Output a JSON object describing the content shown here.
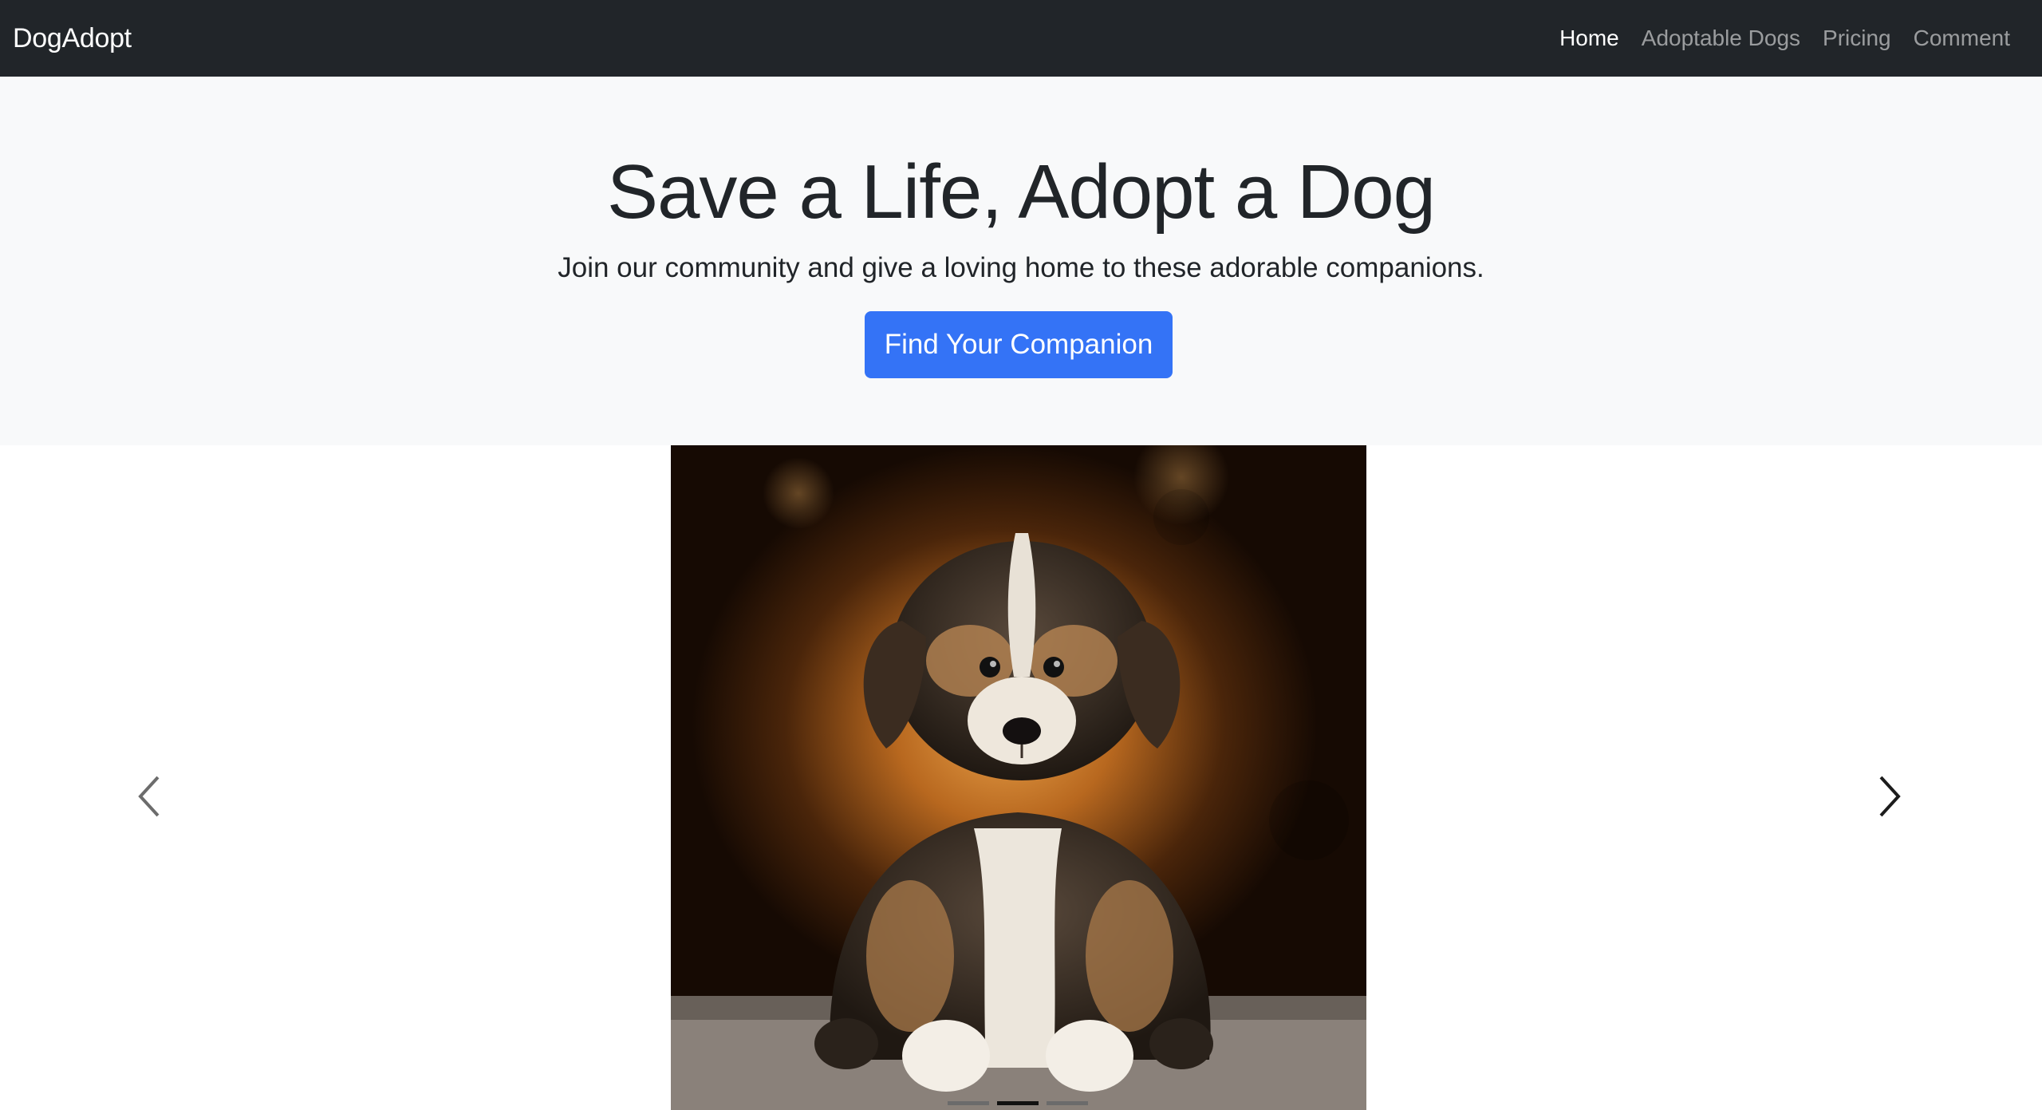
{
  "navbar": {
    "brand": "DogAdopt",
    "links": [
      {
        "label": "Home",
        "active": true
      },
      {
        "label": "Adoptable Dogs",
        "active": false
      },
      {
        "label": "Pricing",
        "active": false
      },
      {
        "label": "Comment",
        "active": false
      }
    ]
  },
  "hero": {
    "title": "Save a Life, Adopt a Dog",
    "subtitle": "Join our community and give a loving home to these adorable companions.",
    "button_label": "Find Your Companion"
  },
  "carousel": {
    "slide_image": "puppy-photo",
    "prev_icon": "chevron-left-icon",
    "next_icon": "chevron-right-icon",
    "indicator_count": 3,
    "active_indicator": 2
  },
  "colors": {
    "navbar_bg": "#212529",
    "hero_bg": "#f8f9fa",
    "primary_button": "#3473f6"
  }
}
